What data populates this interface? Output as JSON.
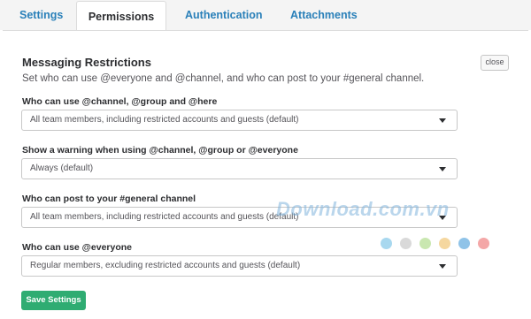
{
  "tabs": [
    {
      "label": "Settings",
      "active": false
    },
    {
      "label": "Permissions",
      "active": true
    },
    {
      "label": "Authentication",
      "active": false
    },
    {
      "label": "Attachments",
      "active": false
    }
  ],
  "section": {
    "title": "Messaging Restrictions",
    "description": "Set who can use @everyone and @channel, and who can post to your #general channel.",
    "close_label": "close"
  },
  "fields": [
    {
      "label": "Who can use @channel, @group and @here",
      "value": "All team members, including restricted accounts and guests (default)"
    },
    {
      "label": "Show a warning when using @channel, @group or @everyone",
      "value": "Always (default)"
    },
    {
      "label": "Who can post to your #general channel",
      "value": "All team members, including restricted accounts and guests (default)"
    },
    {
      "label": "Who can use @everyone",
      "value": "Regular members, excluding restricted accounts and guests (default)"
    }
  ],
  "save_label": "Save Settings",
  "watermark": {
    "text": "Download.com.vn"
  },
  "colors": {
    "accent": "#2a80b9",
    "save_button": "#2fac72",
    "watermark_dots": [
      "#a8d8ef",
      "#d9d9d9",
      "#c9e7b0",
      "#f5d79f",
      "#8fc3e8",
      "#f4a7a7"
    ]
  }
}
